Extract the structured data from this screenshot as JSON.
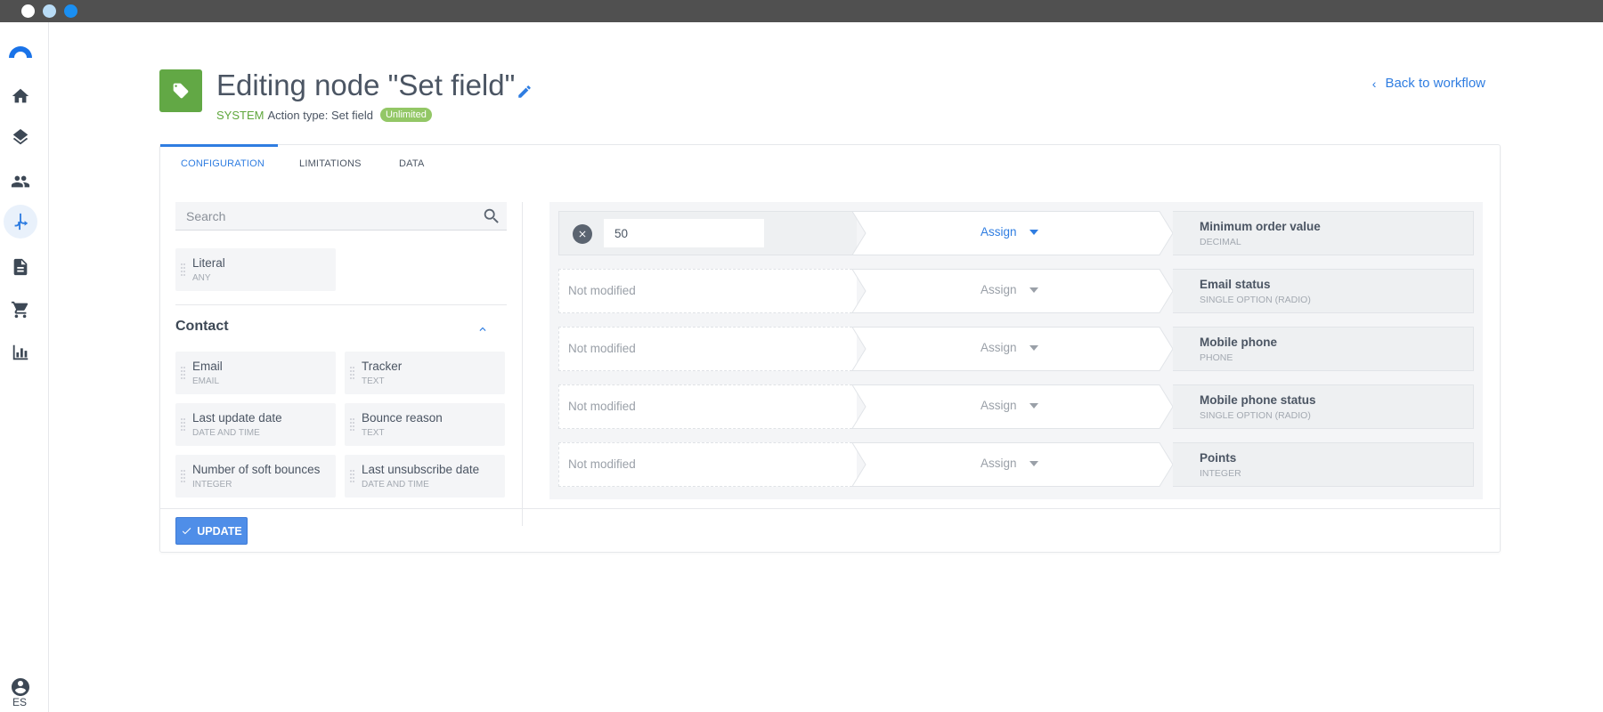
{
  "window": {
    "controls": [
      "close",
      "minimize",
      "maximize"
    ]
  },
  "sidebar": {
    "items": [
      {
        "icon": "home-icon"
      },
      {
        "icon": "layers-icon"
      },
      {
        "icon": "people-icon"
      },
      {
        "icon": "workflow-icon",
        "active": true
      },
      {
        "icon": "document-icon"
      },
      {
        "icon": "cart-icon"
      },
      {
        "icon": "chart-icon"
      }
    ],
    "language": "ES"
  },
  "header": {
    "title": "Editing node \"Set field\"",
    "system_label": "SYSTEM",
    "action_type": "Action type: Set field",
    "limit_badge": "Unlimited",
    "back_label": "Back to workflow",
    "badge_color": "#62a845",
    "accent_color": "#2f7de1"
  },
  "tabs": [
    {
      "label": "CONFIGURATION",
      "active": true
    },
    {
      "label": "LIMITATIONS"
    },
    {
      "label": "DATA"
    }
  ],
  "left_panel": {
    "search_placeholder": "Search",
    "literal": {
      "name": "Literal",
      "type": "ANY"
    },
    "section_title": "Contact",
    "fields": [
      {
        "name": "Email",
        "type": "EMAIL"
      },
      {
        "name": "Tracker",
        "type": "TEXT"
      },
      {
        "name": "Last update date",
        "type": "DATE AND TIME"
      },
      {
        "name": "Bounce reason",
        "type": "TEXT"
      },
      {
        "name": "Number of soft bounces",
        "type": "INTEGER"
      },
      {
        "name": "Last unsubscribe date",
        "type": "DATE AND TIME"
      }
    ]
  },
  "mapping": {
    "rows": [
      {
        "value": "50",
        "operation": "Assign",
        "target": "Minimum order value",
        "target_type": "DECIMAL",
        "filled": true
      },
      {
        "value": "Not modified",
        "operation": "Assign",
        "target": "Email status",
        "target_type": "SINGLE OPTION (RADIO)",
        "filled": false
      },
      {
        "value": "Not modified",
        "operation": "Assign",
        "target": "Mobile phone",
        "target_type": "PHONE",
        "filled": false
      },
      {
        "value": "Not modified",
        "operation": "Assign",
        "target": "Mobile phone status",
        "target_type": "SINGLE OPTION (RADIO)",
        "filled": false
      },
      {
        "value": "Not modified",
        "operation": "Assign",
        "target": "Points",
        "target_type": "INTEGER",
        "filled": false
      }
    ]
  },
  "footer": {
    "update_label": "UPDATE"
  }
}
